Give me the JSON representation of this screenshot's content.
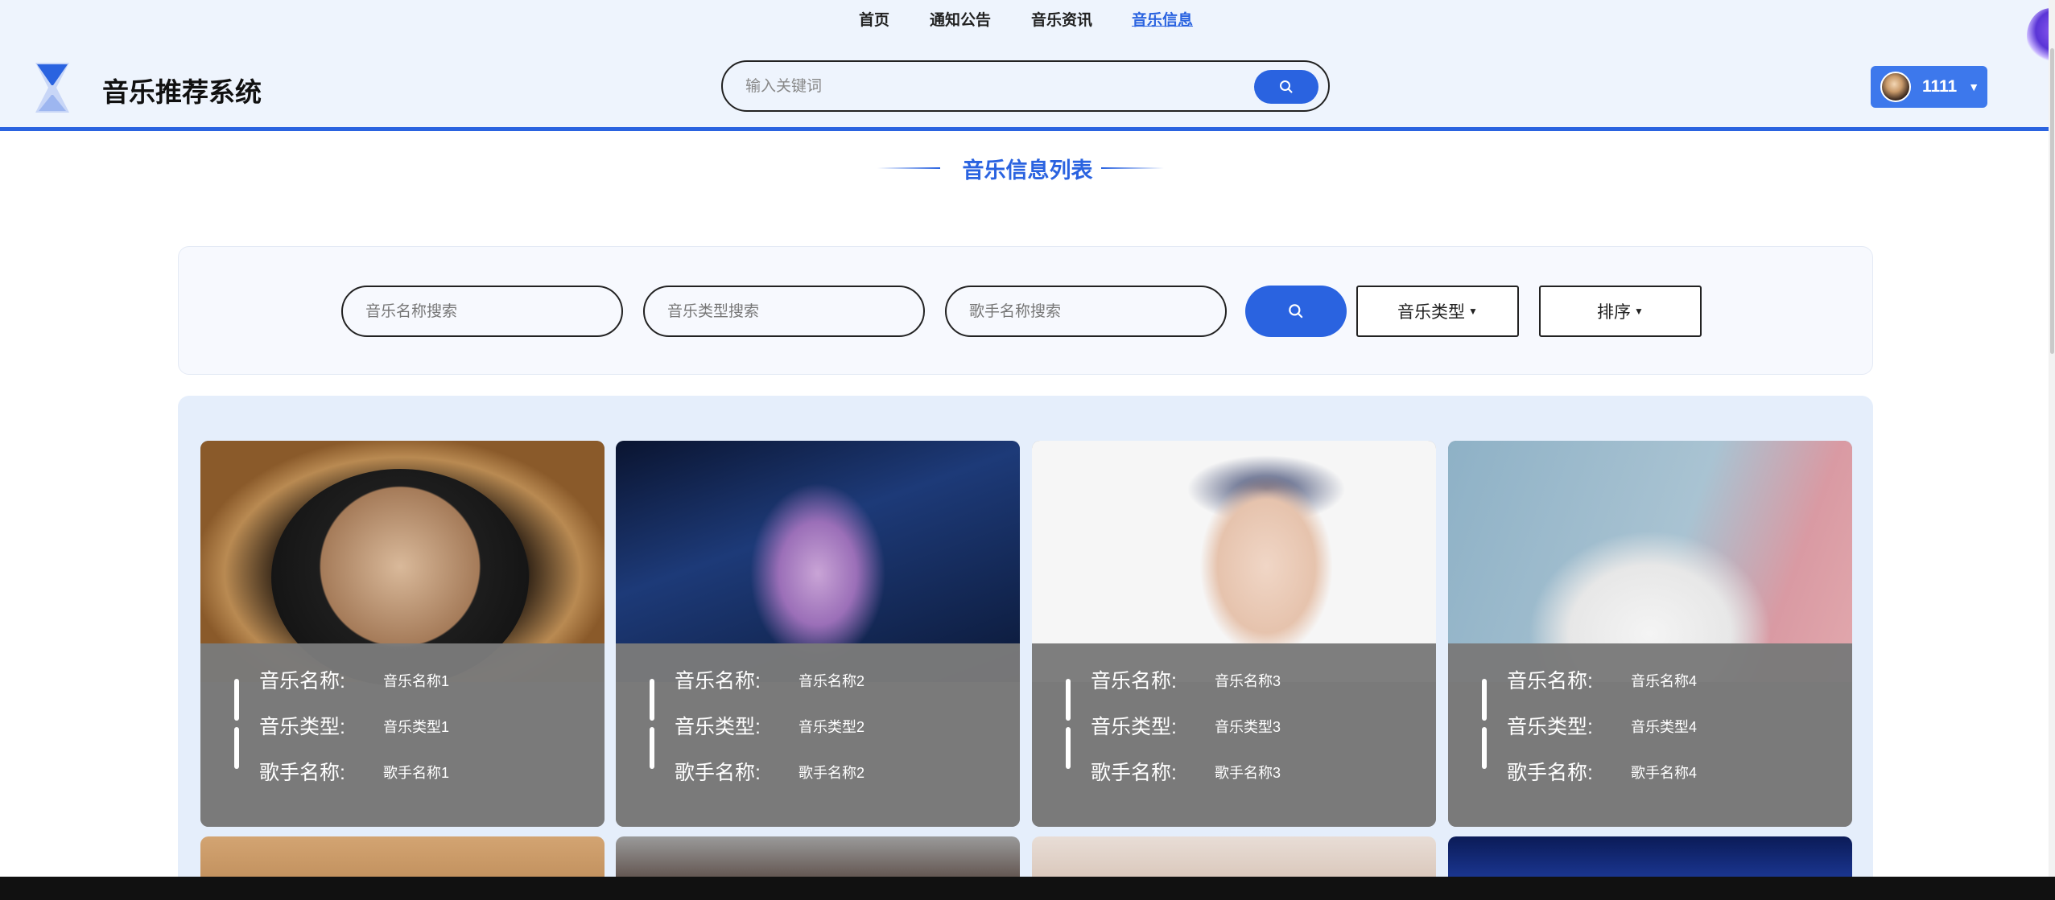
{
  "topnav": {
    "items": [
      {
        "label": "首页",
        "active": false
      },
      {
        "label": "通知公告",
        "active": false
      },
      {
        "label": "音乐资讯",
        "active": false
      },
      {
        "label": "音乐信息",
        "active": true
      }
    ]
  },
  "header": {
    "site_title": "音乐推荐系统",
    "search_placeholder": "输入关键词",
    "username": "1111"
  },
  "section": {
    "title": "音乐信息列表"
  },
  "filters": {
    "music_name_placeholder": "音乐名称搜索",
    "music_type_placeholder": "音乐类型搜索",
    "singer_placeholder": "歌手名称搜索",
    "type_dropdown": "音乐类型",
    "sort_dropdown": "排序"
  },
  "labels": {
    "music_name": "音乐名称:",
    "music_type": "音乐类型:",
    "singer_name": "歌手名称:"
  },
  "cards": [
    {
      "name": "音乐名称1",
      "type": "音乐类型1",
      "singer": "歌手名称1"
    },
    {
      "name": "音乐名称2",
      "type": "音乐类型2",
      "singer": "歌手名称2"
    },
    {
      "name": "音乐名称3",
      "type": "音乐类型3",
      "singer": "歌手名称3"
    },
    {
      "name": "音乐名称4",
      "type": "音乐类型4",
      "singer": "歌手名称4"
    }
  ],
  "colors": {
    "accent": "#2a63e0",
    "header_bg": "#eef4fd",
    "card_overlay": "#7a7a7a"
  }
}
